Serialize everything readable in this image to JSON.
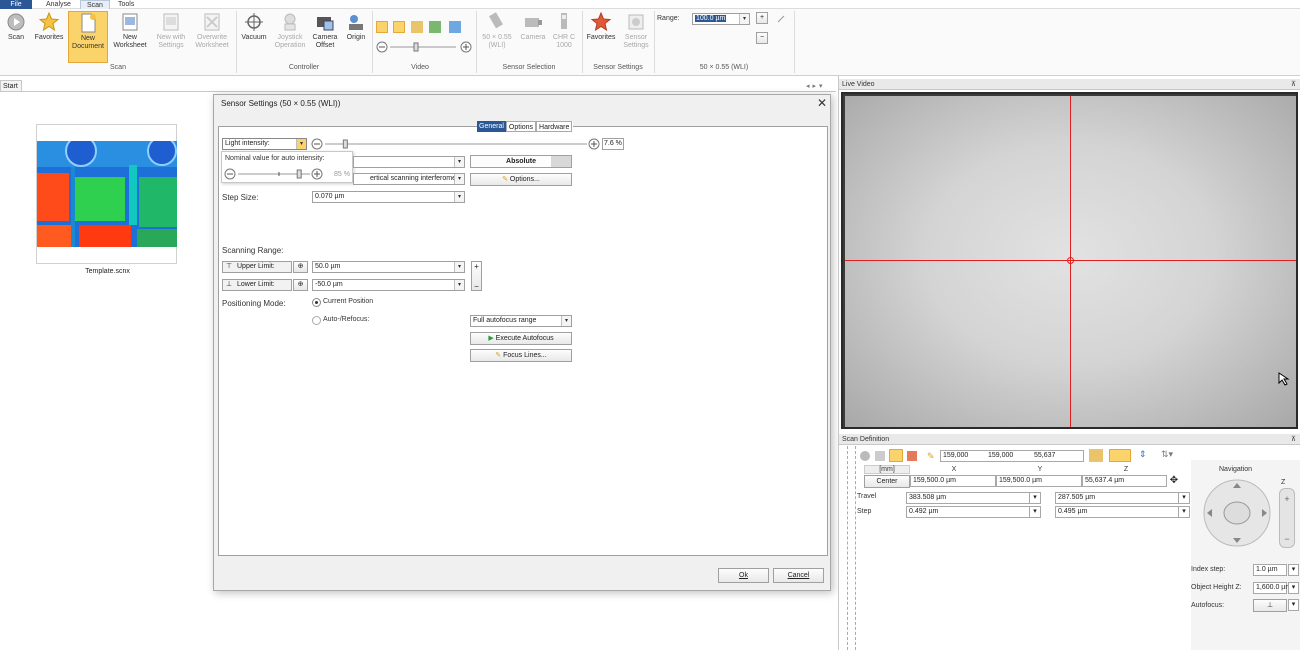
{
  "menubar": {
    "items": [
      "File",
      "Analyse",
      "Scan",
      "Tools"
    ]
  },
  "ribbon": {
    "scan_group": {
      "label": "Scan",
      "buttons": [
        "Scan",
        "Favorites",
        "New Document",
        "New Worksheet",
        "New with Settings",
        "Overwrite Worksheet"
      ]
    },
    "controller_group": {
      "label": "Controller",
      "buttons": [
        "Vacuum",
        "Joystick Operation",
        "Camera Offset",
        "Origin"
      ]
    },
    "video_group": {
      "label": "Video"
    },
    "sensor_selection_group": {
      "label": "Sensor Selection",
      "buttons": [
        "50 × 0.55 (WLI)",
        "Camera",
        "CHR C 1000"
      ]
    },
    "sensor_settings_group": {
      "label": "Sensor Settings",
      "buttons": [
        "Favorites",
        "Sensor Settings"
      ]
    },
    "range_group": {
      "label": "50 × 0.55 (WLI)",
      "range_label": "Range:",
      "range_value": "100.0 µm"
    }
  },
  "start_tab": {
    "label": "Start"
  },
  "thumbnail": {
    "filename": "Template.scnx"
  },
  "dialog": {
    "title": "Sensor Settings (50 × 0.55 (WLI))",
    "tabs": [
      "General",
      "Options",
      "Hardware"
    ],
    "light_intensity_label": "Light intensity:",
    "light_intensity_value": "7.6 %",
    "tooltip_title": "Nominal value for auto intensity:",
    "tooltip_value": "85 %",
    "combo1_value": "",
    "absolute_label": "Absolute",
    "mode_value": "Vertical scanning interferometry",
    "mode_visible": "ertical scanning interferometry",
    "options_button": "Options...",
    "step_size_label": "Step Size:",
    "step_size_value": "0.070 µm",
    "scanning_range_label": "Scanning Range:",
    "upper_limit_label": "Upper Limit:",
    "upper_limit_value": "50.0 µm",
    "lower_limit_label": "Lower Limit:",
    "lower_limit_value": "-50.0 µm",
    "positioning_mode_label": "Positioning Mode:",
    "current_position_label": "Current Position",
    "auto_refocus_label": "Auto-/Refocus:",
    "autofocus_range_value": "Full autofocus range",
    "execute_autofocus_button": "Execute Autofocus",
    "focus_lines_button": "Focus Lines...",
    "ok_button": "Ok",
    "cancel_button": "Cancel",
    "light_intensity_level": 0.076,
    "auto_intensity_level": 0.85
  },
  "live_video": {
    "title": "Live Video"
  },
  "scan_definition": {
    "title": "Scan Definition",
    "toolbar_values": [
      "159,000",
      "159,000",
      "55,637"
    ],
    "unit_header": "[mm]",
    "axes": [
      "X",
      "Y",
      "Z"
    ],
    "center_label": "Center",
    "center_values": [
      "159,500.0 µm",
      "159,500.0 µm",
      "55,637.4 µm"
    ],
    "travel_label": "Travel",
    "travel_values": [
      "383.508 µm",
      "287.505 µm"
    ],
    "step_label": "Step",
    "step_values": [
      "0.492 µm",
      "0.495 µm"
    ],
    "navigation_label": "Navigation",
    "z_label": "Z",
    "index_step_label": "Index step:",
    "index_step_value": "1.0 µm",
    "object_height_label": "Object Height Z:",
    "object_height_value": "1,600.0 µm",
    "autofocus_label": "Autofocus:"
  },
  "colors": {
    "accent": "#2b5797",
    "crosshair": "#e02020",
    "highlight": "#fbd36b"
  }
}
